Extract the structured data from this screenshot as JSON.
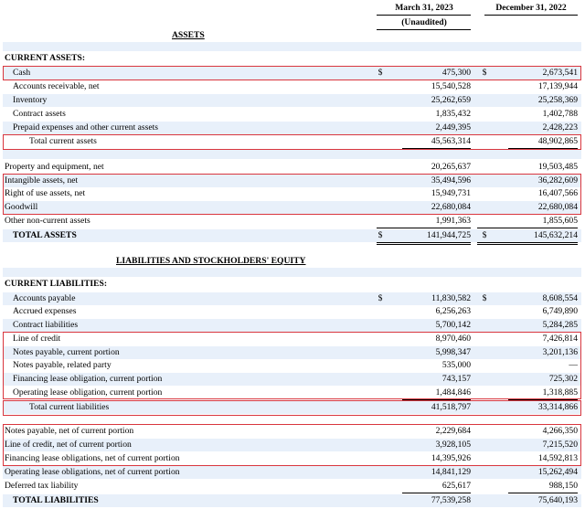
{
  "header": {
    "col1_title": "March 31, 2023",
    "col1_sub": "(Unaudited)",
    "col2_title": "December 31, 2022"
  },
  "assets_heading": "ASSETS",
  "current_assets_heading": "CURRENT ASSETS:",
  "current_assets": [
    {
      "label": "Cash",
      "dollar1": "$",
      "v1": "475,300",
      "dollar2": "$",
      "v2": "2,673,541"
    },
    {
      "label": "Accounts receivable, net",
      "v1": "15,540,528",
      "v2": "17,139,944"
    },
    {
      "label": "Inventory",
      "v1": "25,262,659",
      "v2": "25,258,369"
    },
    {
      "label": "Contract assets",
      "v1": "1,835,432",
      "v2": "1,402,788"
    },
    {
      "label": "Prepaid expenses and other current assets",
      "v1": "2,449,395",
      "v2": "2,428,223"
    },
    {
      "label": "Total current assets",
      "v1": "45,563,314",
      "v2": "48,902,865"
    }
  ],
  "noncurrent_assets": [
    {
      "label": "Property and equipment, net",
      "v1": "20,265,637",
      "v2": "19,503,485"
    },
    {
      "label": "Intangible assets, net",
      "v1": "35,494,596",
      "v2": "36,282,609"
    },
    {
      "label": "Right of use assets, net",
      "v1": "15,949,731",
      "v2": "16,407,566"
    },
    {
      "label": "Goodwill",
      "v1": "22,680,084",
      "v2": "22,680,084"
    },
    {
      "label": "Other non-current assets",
      "v1": "1,991,363",
      "v2": "1,855,605"
    }
  ],
  "total_assets": {
    "label": "TOTAL ASSETS",
    "dollar1": "$",
    "v1": "141,944,725",
    "dollar2": "$",
    "v2": "145,632,214"
  },
  "liab_heading": "LIABILITIES AND STOCKHOLDERS' EQUITY",
  "current_liab_heading": "CURRENT LIABILITIES:",
  "current_liabilities": [
    {
      "label": "Accounts payable",
      "dollar1": "$",
      "v1": "11,830,582",
      "dollar2": "$",
      "v2": "8,608,554"
    },
    {
      "label": "Accrued expenses",
      "v1": "6,256,263",
      "v2": "6,749,890"
    },
    {
      "label": "Contract liabilities",
      "v1": "5,700,142",
      "v2": "5,284,285"
    },
    {
      "label": "Line of credit",
      "v1": "8,970,460",
      "v2": "7,426,814"
    },
    {
      "label": "Notes payable, current portion",
      "v1": "5,998,347",
      "v2": "3,201,136"
    },
    {
      "label": "Notes payable, related party",
      "v1": "535,000",
      "v2": "—"
    },
    {
      "label": "Financing lease obligation, current portion",
      "v1": "743,157",
      "v2": "725,302"
    },
    {
      "label": "Operating lease obligation, current portion",
      "v1": "1,484,846",
      "v2": "1,318,885"
    },
    {
      "label": "Total current liabilities",
      "v1": "41,518,797",
      "v2": "33,314,866"
    }
  ],
  "noncurrent_liabilities": [
    {
      "label": "Notes payable, net of current portion",
      "v1": "2,229,684",
      "v2": "4,266,350"
    },
    {
      "label": "Line of credit, net of current portion",
      "v1": "3,928,105",
      "v2": "7,215,520"
    },
    {
      "label": "Financing lease obligations, net of current portion",
      "v1": "14,395,926",
      "v2": "14,592,813"
    },
    {
      "label": "Operating lease obligations, net of current portion",
      "v1": "14,841,129",
      "v2": "15,262,494"
    },
    {
      "label": "Deferred tax liability",
      "v1": "625,617",
      "v2": "988,150"
    }
  ],
  "total_liabilities": {
    "label": "TOTAL LIABILITIES",
    "v1": "77,539,258",
    "v2": "75,640,193"
  }
}
